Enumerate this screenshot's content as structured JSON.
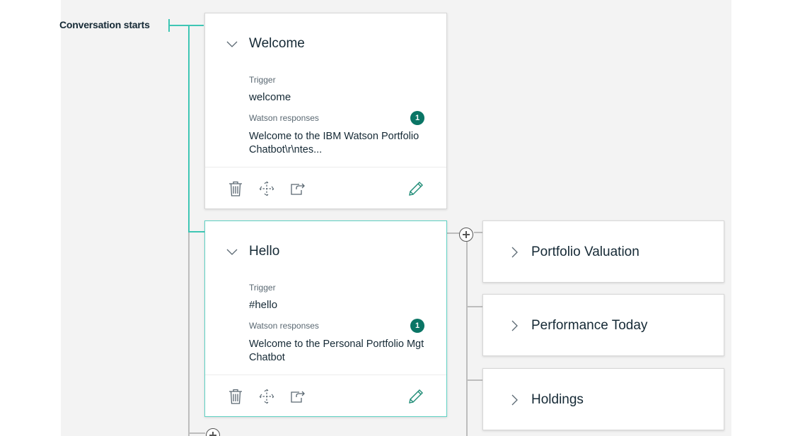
{
  "tree": {
    "root_label": "Conversation starts"
  },
  "nodes": [
    {
      "title": "Welcome",
      "trigger_label": "Trigger",
      "trigger_value": "welcome",
      "responses_label": "Watson responses",
      "responses_count": "1",
      "response_text": "Welcome to the IBM Watson Portfolio Chatbot\\r\\ntes..."
    },
    {
      "title": "Hello",
      "trigger_label": "Trigger",
      "trigger_value": "#hello",
      "responses_label": "Watson responses",
      "responses_count": "1",
      "response_text": "Welcome to the Personal Portfolio Mgt Chatbot"
    }
  ],
  "children": [
    {
      "title": "Portfolio Valuation"
    },
    {
      "title": "Performance Today"
    },
    {
      "title": "Holdings"
    }
  ],
  "icons": {
    "collapse": "chevron-down-icon",
    "expand": "chevron-right-icon",
    "delete": "trash-icon",
    "move": "move-icon",
    "jump": "jump-to-icon",
    "edit": "pencil-icon",
    "add": "add-circle-icon"
  },
  "colors": {
    "tree_line_active": "#3ec6b4",
    "tree_line": "#bdbdbd",
    "badge": "#0a7565",
    "edit_icon": "#1d8b75"
  }
}
